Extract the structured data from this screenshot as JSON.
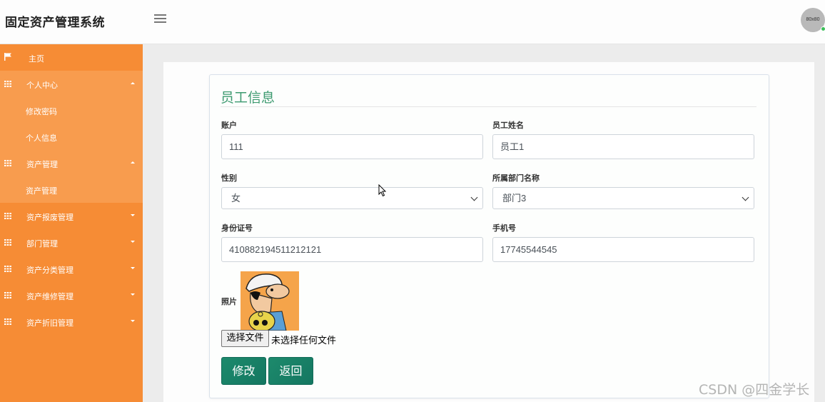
{
  "header": {
    "app_title": "固定资产管理系统",
    "avatar_text": "80x80"
  },
  "sidebar": {
    "home": "主页",
    "personal_center": "个人中心",
    "change_password": "修改密码",
    "personal_info": "个人信息",
    "asset_mgmt": "资产管理",
    "asset_mgmt_sub": "资产管理",
    "asset_scrap": "资产报废管理",
    "dept_mgmt": "部门管理",
    "asset_category": "资产分类管理",
    "asset_repair": "资产维修管理",
    "asset_depreciation": "资产折旧管理"
  },
  "form": {
    "title": "员工信息",
    "account_label": "账户",
    "account_value": "111",
    "name_label": "员工姓名",
    "name_value": "员工1",
    "gender_label": "性别",
    "gender_value": "女",
    "dept_label": "所属部门名称",
    "dept_value": "部门3",
    "id_label": "身份证号",
    "id_value": "410882194511212121",
    "phone_label": "手机号",
    "phone_value": "17745544545",
    "photo_label": "照片",
    "file_button": "选择文件",
    "file_status": "未选择任何文件",
    "edit_button": "修改",
    "back_button": "返回"
  },
  "watermark": "CSDN @四金学长",
  "colors": {
    "sidebar": "#f68c35",
    "sidebar_active": "#f89c4e",
    "accent_green": "#3d9a70",
    "button": "#1d8a6c"
  }
}
